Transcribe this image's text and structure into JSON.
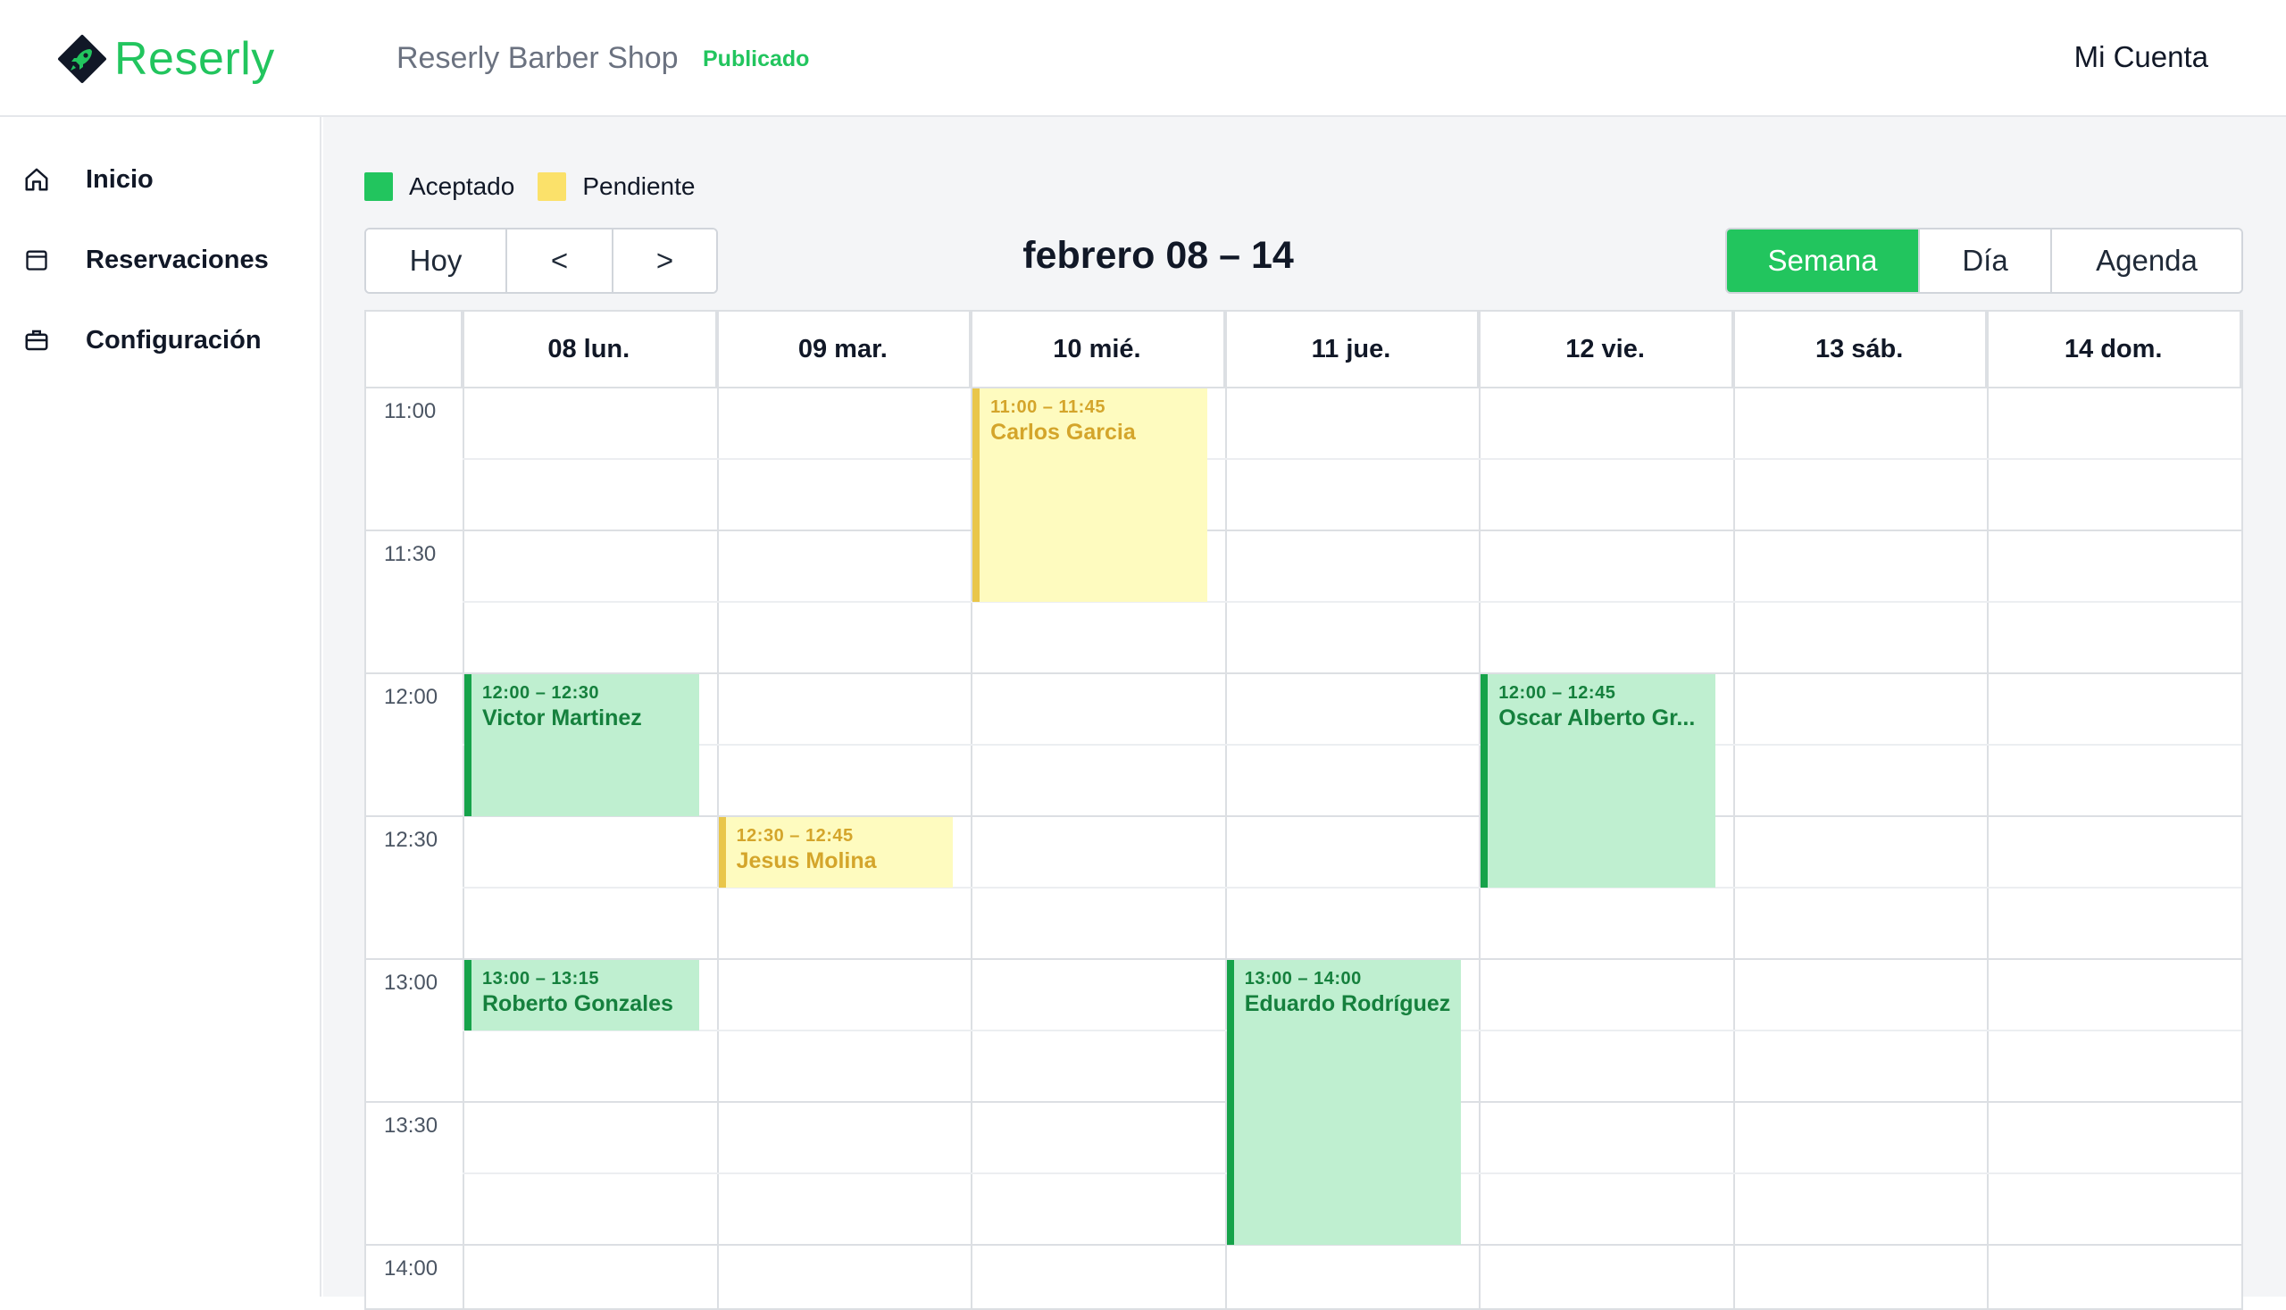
{
  "brand": {
    "name": "Reserly",
    "color": "#22c55e"
  },
  "header": {
    "shop_name": "Reserly Barber Shop",
    "status": "Publicado",
    "account": "Mi Cuenta"
  },
  "sidebar": {
    "items": [
      {
        "label": "Inicio",
        "icon": "home-icon"
      },
      {
        "label": "Reservaciones",
        "icon": "calendar-icon"
      },
      {
        "label": "Configuración",
        "icon": "briefcase-icon"
      }
    ]
  },
  "legend": [
    {
      "label": "Aceptado",
      "color": "#22c55e"
    },
    {
      "label": "Pendiente",
      "color": "#fbe16a"
    }
  ],
  "toolbar": {
    "today": "Hoy",
    "prev": "<",
    "next": ">",
    "range_title": "febrero 08 – 14",
    "views": [
      "Semana",
      "Día",
      "Agenda"
    ],
    "active_view": "Semana"
  },
  "calendar": {
    "days": [
      "08 lun.",
      "09 mar.",
      "10 mié.",
      "11 jue.",
      "12 vie.",
      "13 sáb.",
      "14 dom."
    ],
    "times": [
      "11:00",
      "11:30",
      "12:00",
      "12:30",
      "13:00",
      "13:30",
      "14:00"
    ],
    "events": [
      {
        "day": 2,
        "start": "11:00",
        "end": "11:45",
        "time": "11:00 – 11:45",
        "name": "Carlos Garcia",
        "status": "pending"
      },
      {
        "day": 0,
        "start": "12:00",
        "end": "12:30",
        "time": "12:00 – 12:30",
        "name": "Victor Martinez",
        "status": "accepted"
      },
      {
        "day": 4,
        "start": "12:00",
        "end": "12:45",
        "time": "12:00 – 12:45",
        "name": "Oscar Alberto Gr...",
        "status": "accepted"
      },
      {
        "day": 1,
        "start": "12:30",
        "end": "12:45",
        "time": "12:30 – 12:45",
        "name": "Jesus Molina",
        "status": "pending"
      },
      {
        "day": 0,
        "start": "13:00",
        "end": "13:15",
        "time": "13:00 – 13:15",
        "name": "Roberto Gonzales",
        "status": "accepted"
      },
      {
        "day": 3,
        "start": "13:00",
        "end": "14:00",
        "time": "13:00 – 14:00",
        "name": "Eduardo Rodríguez",
        "status": "accepted"
      }
    ]
  }
}
